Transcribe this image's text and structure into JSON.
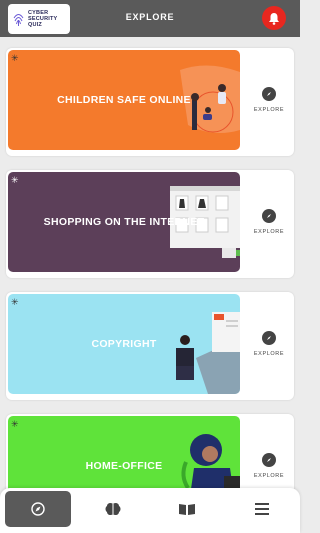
{
  "header": {
    "logo_text": [
      "CYBER",
      "SECURITY",
      "QUIZ"
    ],
    "title": "EXPLORE",
    "notification_color": "#e8271f"
  },
  "cards": [
    {
      "title": "CHILDREN SAFE ONLINE",
      "color": "#f47a2c",
      "explore_label": "EXPLORE"
    },
    {
      "title": "SHOPPING ON THE INTERNET",
      "color": "#5c3f59",
      "explore_label": "EXPLORE"
    },
    {
      "title": "COPYRIGHT",
      "color": "#9be3f2",
      "explore_label": "EXPLORE"
    },
    {
      "title": "HOME-OFFICE",
      "color": "#5fe33a",
      "explore_label": "EXPLORE"
    }
  ],
  "bottom_nav": {
    "items": [
      {
        "icon": "compass-icon",
        "active": true
      },
      {
        "icon": "brain-icon",
        "active": false
      },
      {
        "icon": "book-icon",
        "active": false
      },
      {
        "icon": "menu-icon",
        "active": false
      }
    ]
  }
}
